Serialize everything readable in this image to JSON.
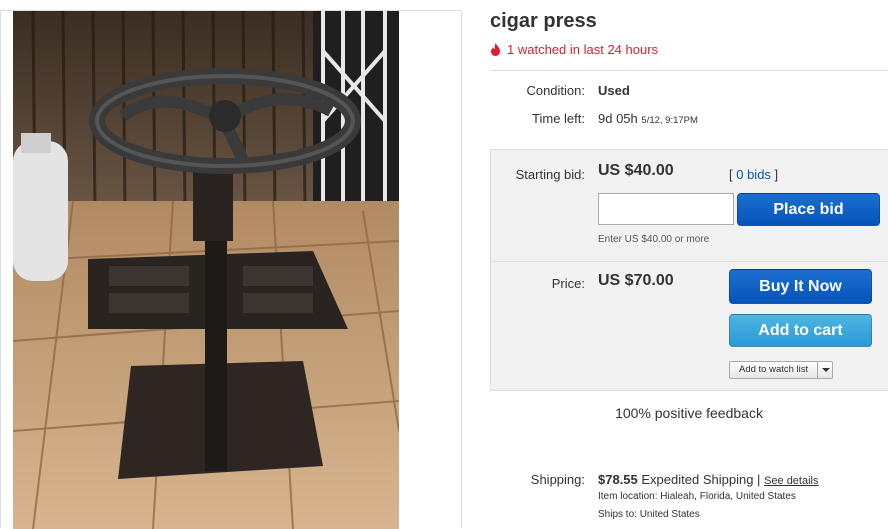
{
  "listing": {
    "title": "cigar press",
    "watched": "1 watched in last 24 hours",
    "condition_label": "Condition:",
    "condition_value": "Used",
    "time_left_label": "Time left:",
    "time_left_value": "9d 05h",
    "time_left_end": "5/12, 9:17PM"
  },
  "bid": {
    "label": "Starting bid:",
    "price": "US $40.00",
    "bids_open": "[ ",
    "bids_link": "0 bids",
    "bids_close": " ]",
    "input_value": "",
    "button": "Place bid",
    "hint": "Enter US $40.00 or more"
  },
  "buy": {
    "label": "Price:",
    "price": "US $70.00",
    "buy_now": "Buy It Now",
    "add_to_cart": "Add to cart",
    "watch_list": "Add to watch list"
  },
  "feedback": "100% positive feedback",
  "shipping": {
    "label": "Shipping:",
    "cost": "$78.55",
    "method": "Expedited Shipping",
    "divider": "|",
    "details_link": "See details",
    "location_label": "Item location:",
    "location": "Hialeah, Florida, United States",
    "ships_to_label": "Ships to:",
    "ships_to": "United States"
  },
  "colors": {
    "alert_red": "#dd1e31",
    "primary_blue": "#0654ba",
    "secondary_blue": "#2a9ad6",
    "panel_gray": "#f2f2f2"
  },
  "icons": {
    "watch_icon": "flame-icon",
    "dropdown_icon": "chevron-down-icon"
  }
}
